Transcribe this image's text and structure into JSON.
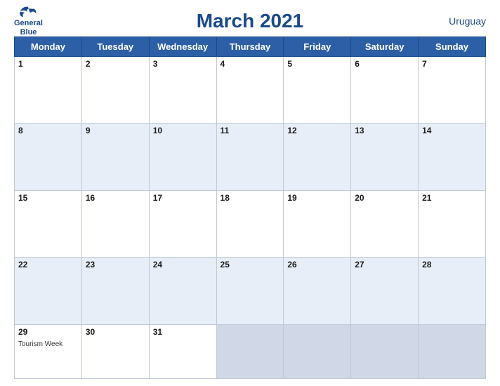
{
  "header": {
    "title": "March 2021",
    "country": "Uruguay",
    "logo_general": "General",
    "logo_blue": "Blue"
  },
  "weekdays": [
    "Monday",
    "Tuesday",
    "Wednesday",
    "Thursday",
    "Friday",
    "Saturday",
    "Sunday"
  ],
  "weeks": [
    [
      {
        "day": "1",
        "event": ""
      },
      {
        "day": "2",
        "event": ""
      },
      {
        "day": "3",
        "event": ""
      },
      {
        "day": "4",
        "event": ""
      },
      {
        "day": "5",
        "event": ""
      },
      {
        "day": "6",
        "event": ""
      },
      {
        "day": "7",
        "event": ""
      }
    ],
    [
      {
        "day": "8",
        "event": ""
      },
      {
        "day": "9",
        "event": ""
      },
      {
        "day": "10",
        "event": ""
      },
      {
        "day": "11",
        "event": ""
      },
      {
        "day": "12",
        "event": ""
      },
      {
        "day": "13",
        "event": ""
      },
      {
        "day": "14",
        "event": ""
      }
    ],
    [
      {
        "day": "15",
        "event": ""
      },
      {
        "day": "16",
        "event": ""
      },
      {
        "day": "17",
        "event": ""
      },
      {
        "day": "18",
        "event": ""
      },
      {
        "day": "19",
        "event": ""
      },
      {
        "day": "20",
        "event": ""
      },
      {
        "day": "21",
        "event": ""
      }
    ],
    [
      {
        "day": "22",
        "event": ""
      },
      {
        "day": "23",
        "event": ""
      },
      {
        "day": "24",
        "event": ""
      },
      {
        "day": "25",
        "event": ""
      },
      {
        "day": "26",
        "event": ""
      },
      {
        "day": "27",
        "event": ""
      },
      {
        "day": "28",
        "event": ""
      }
    ],
    [
      {
        "day": "29",
        "event": "Tourism Week"
      },
      {
        "day": "30",
        "event": ""
      },
      {
        "day": "31",
        "event": ""
      },
      {
        "day": "",
        "event": ""
      },
      {
        "day": "",
        "event": ""
      },
      {
        "day": "",
        "event": ""
      },
      {
        "day": "",
        "event": ""
      }
    ]
  ]
}
